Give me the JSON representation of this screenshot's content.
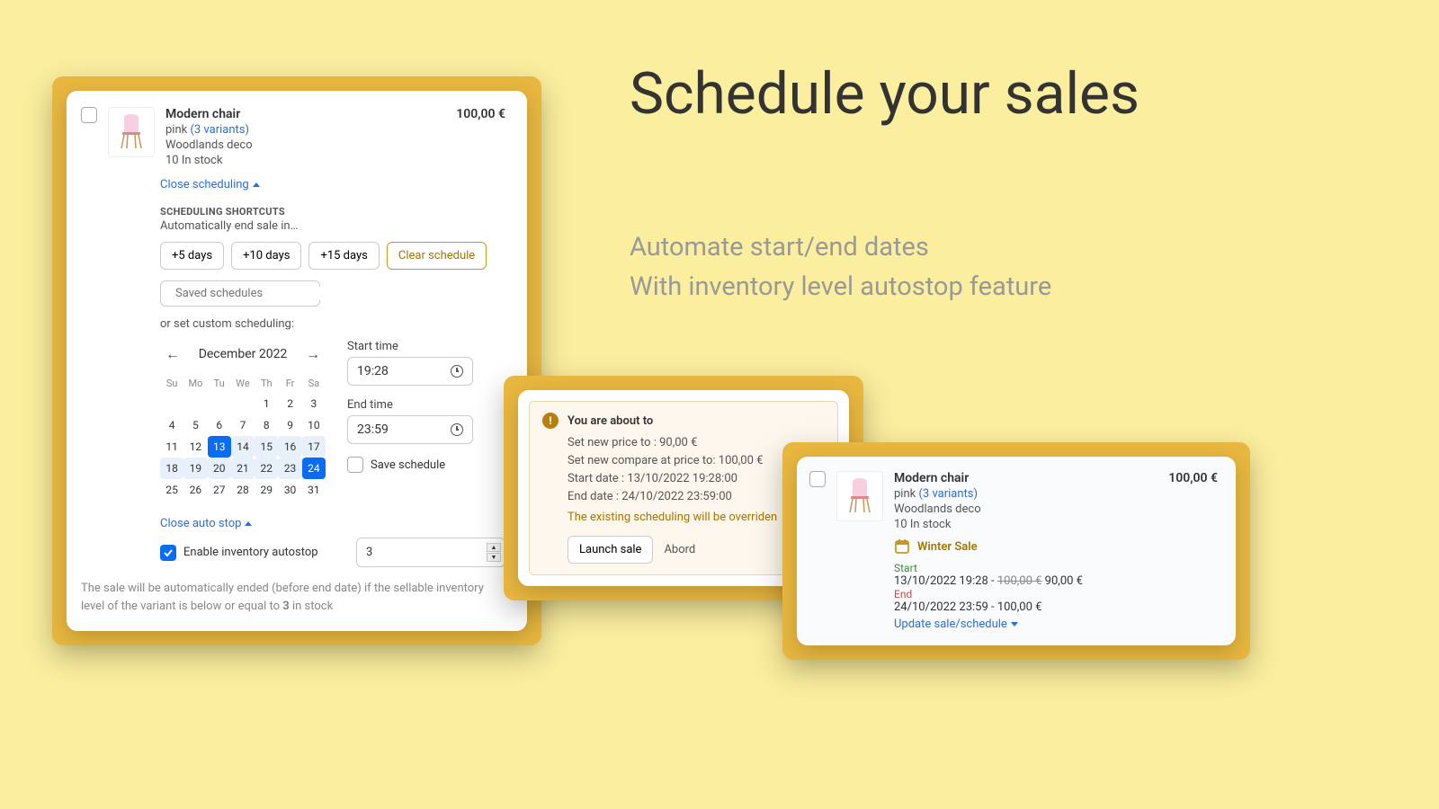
{
  "hero": {
    "title": "Schedule your sales",
    "sub1": "Automate start/end dates",
    "sub2": "With inventory level autostop feature"
  },
  "product": {
    "title": "Modern chair",
    "color": "pink",
    "variants_link": "(3 variants)",
    "brand": "Woodlands deco",
    "stock": "10 In stock",
    "price": "100,00 €"
  },
  "scheduling": {
    "close_label": "Close scheduling",
    "shortcuts_label": "SCHEDULING SHORTCUTS",
    "shortcuts_sub": "Automatically end sale in…",
    "btn5": "+5 days",
    "btn10": "+10 days",
    "btn15": "+15 days",
    "clear": "Clear schedule",
    "search_placeholder": "Saved schedules",
    "custom_text": "or set custom scheduling:",
    "month": "December 2022",
    "dow": [
      "Su",
      "Mo",
      "Tu",
      "We",
      "Th",
      "Fr",
      "Sa"
    ],
    "start_label": "Start time",
    "start_value": "19:28",
    "end_label": "End time",
    "end_value": "23:59",
    "save_label": "Save schedule"
  },
  "autostop": {
    "close_label": "Close auto stop",
    "enable_label": "Enable inventory autostop",
    "value": "3",
    "note_pre": "The sale will be automatically ended (before end date) if the sellable inventory level of the variant is below or equal to ",
    "note_bold": "3",
    "note_post": " in stock"
  },
  "confirm": {
    "title": "You are about to",
    "line1": "Set new price to : 90,00 €",
    "line2": "Set new compare at price to: 100,00 €",
    "line3": "Start date : 13/10/2022 19:28:00",
    "line4": "End date : 24/10/2022 23:59:00",
    "warn": "The existing scheduling will be overriden",
    "launch": "Launch sale",
    "abort": "Abord"
  },
  "summary": {
    "sale_name": "Winter Sale",
    "start_label": "Start",
    "start_value_pre": "13/10/2022 19:28 - ",
    "start_strike": "100,00 €",
    "start_value_post": " 90,00 €",
    "end_label": "End",
    "end_value": "24/10/2022 23:59 - 100,00 €",
    "update_link": "Update sale/schedule"
  }
}
